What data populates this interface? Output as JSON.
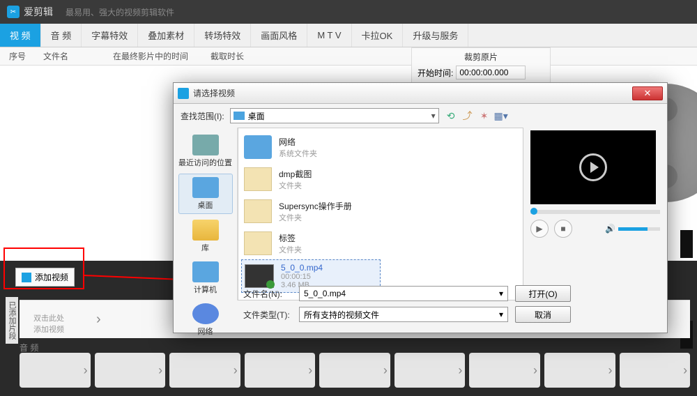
{
  "header": {
    "app_name": "爱剪辑",
    "slogan": "最易用、强大的视频剪辑软件"
  },
  "tabs": [
    "视 频",
    "音 频",
    "字幕特效",
    "叠加素材",
    "转场特效",
    "画面风格",
    "M T V",
    "卡拉OK",
    "升级与服务"
  ],
  "columns": {
    "c1": "序号",
    "c2": "文件名",
    "c3": "在最终影片中的时间",
    "c4": "截取时长"
  },
  "crop": {
    "title": "裁剪原片",
    "start_label": "开始时间:",
    "start_value": "00:00:00.000"
  },
  "add_video_btn": "添加视频",
  "track_label": "已添加片段",
  "hint": {
    "l1": "双击此处",
    "l2": "添加视频"
  },
  "audio_label": "音 频",
  "dialog": {
    "title": "请选择视频",
    "look_in_label": "查找范围(I):",
    "look_in_value": "桌面",
    "places": {
      "recent": "最近访问的位置",
      "desktop": "桌面",
      "library": "库",
      "computer": "计算机",
      "network": "网络"
    },
    "files": [
      {
        "name": "网络",
        "sub": "系统文件夹",
        "kind": "net"
      },
      {
        "name": "dmp截图",
        "sub": "文件夹",
        "kind": "folder"
      },
      {
        "name": "Supersync操作手册",
        "sub": "文件夹",
        "kind": "folder"
      },
      {
        "name": "标签",
        "sub": "文件夹",
        "kind": "folder"
      }
    ],
    "selected_file": {
      "name": "5_0_0.mp4",
      "duration": "00:00:15",
      "size": "3.46 MB"
    },
    "filename_label": "文件名(N):",
    "filename_value": "5_0_0.mp4",
    "filetype_label": "文件类型(T):",
    "filetype_value": "所有支持的视频文件",
    "open_btn": "打开(O)",
    "cancel_btn": "取消"
  }
}
